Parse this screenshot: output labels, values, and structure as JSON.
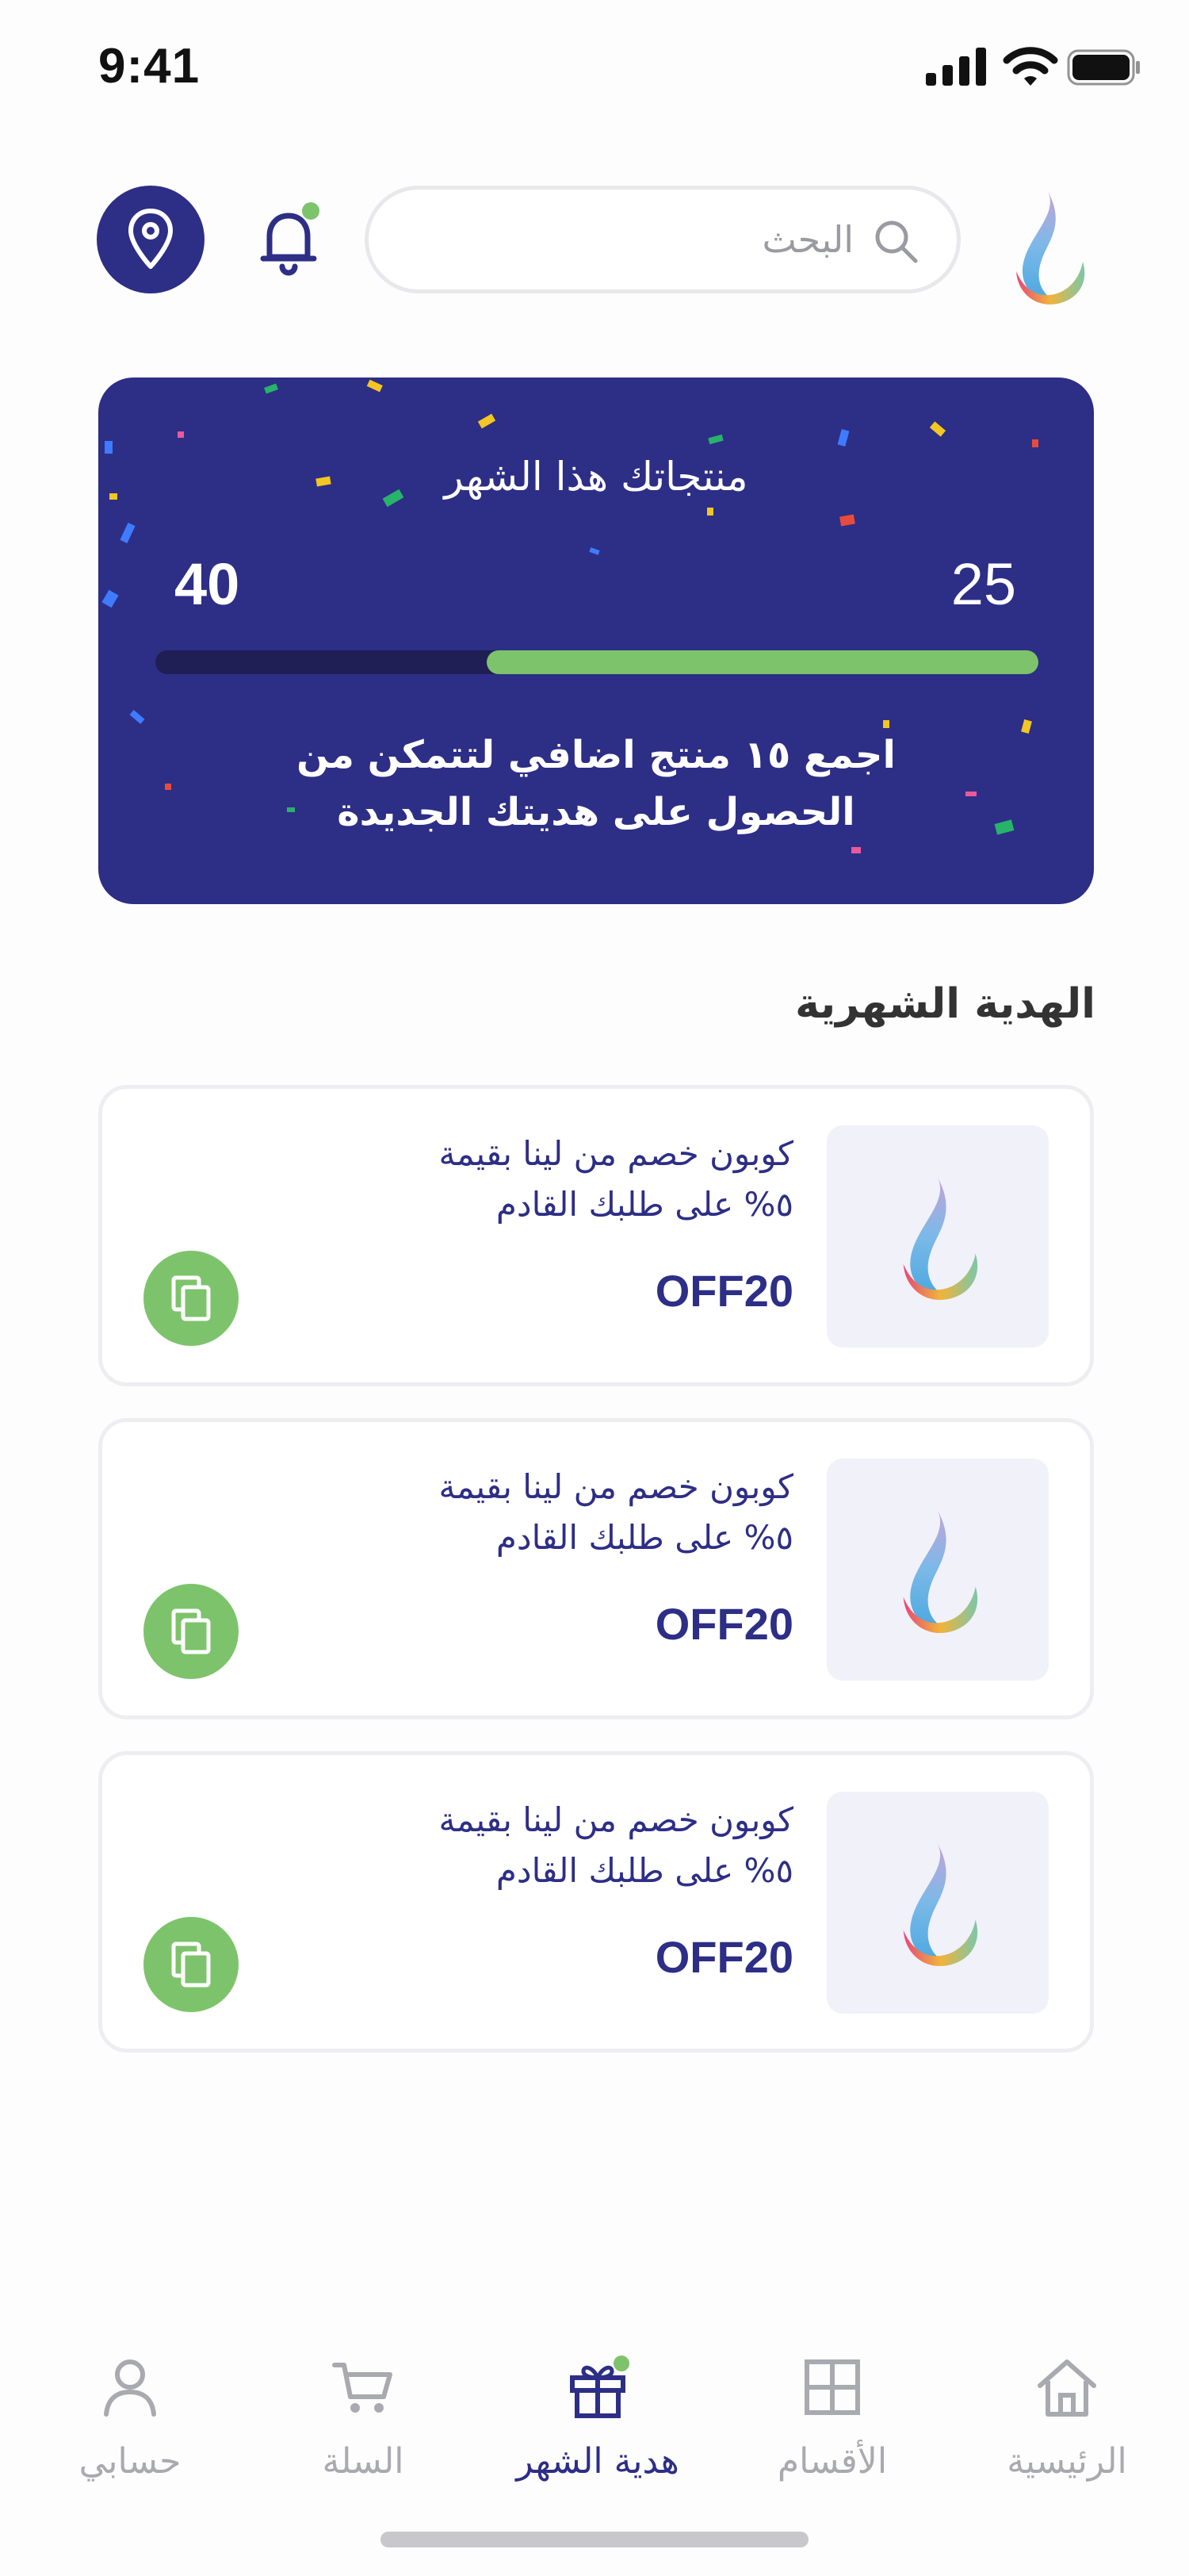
{
  "status_bar": {
    "time": "9:41"
  },
  "header": {
    "search_placeholder": "البحث"
  },
  "banner": {
    "title": "منتجاتك هذا الشهر",
    "current": "25",
    "target": "40",
    "progress_fraction": 0.625,
    "message_line1": "اجمع ١٥ منتج اضافي لتتمكن من",
    "message_line2": "الحصول على هديتك الجديدة"
  },
  "section": {
    "title": "الهدية الشهرية"
  },
  "coupons": [
    {
      "line1": "كوبون خصم من لينا بقيمة",
      "line2": "٥% على طلبك القادم",
      "code": "OFF20"
    },
    {
      "line1": "كوبون خصم من لينا بقيمة",
      "line2": "٥% على طلبك القادم",
      "code": "OFF20"
    },
    {
      "line1": "كوبون خصم من لينا بقيمة",
      "line2": "٥% على طلبك القادم",
      "code": "OFF20"
    }
  ],
  "tabbar": {
    "items": [
      {
        "label": "حسابي",
        "icon": "user-icon"
      },
      {
        "label": "السلة",
        "icon": "cart-icon"
      },
      {
        "label": "هدية الشهر",
        "icon": "gift-icon",
        "active": true
      },
      {
        "label": "الأقسام",
        "icon": "grid-icon"
      },
      {
        "label": "الرئيسية",
        "icon": "home-icon"
      }
    ]
  },
  "colors": {
    "primary": "#2d2e86",
    "accent": "#7dc36b",
    "muted": "#a9a9b0"
  }
}
